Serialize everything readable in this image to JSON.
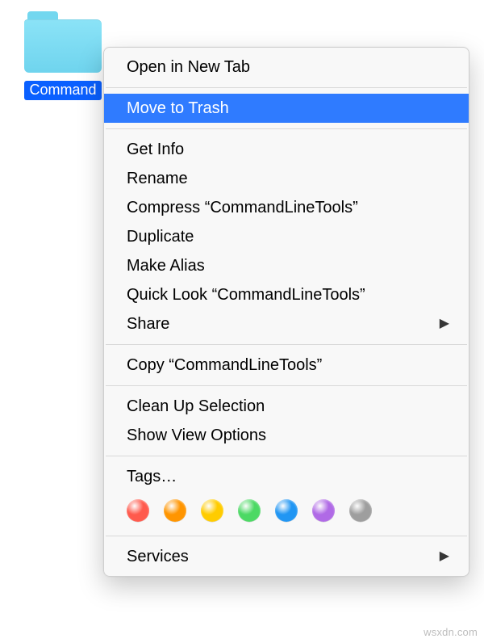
{
  "folder": {
    "label": "Command"
  },
  "menu": {
    "open_new_tab": "Open in New Tab",
    "move_to_trash": "Move to Trash",
    "get_info": "Get Info",
    "rename": "Rename",
    "compress": "Compress “CommandLineTools”",
    "duplicate": "Duplicate",
    "make_alias": "Make Alias",
    "quick_look": "Quick Look “CommandLineTools”",
    "share": "Share",
    "copy": "Copy “CommandLineTools”",
    "clean_up": "Clean Up Selection",
    "show_view_options": "Show View Options",
    "tags": "Tags…",
    "services": "Services"
  },
  "tag_colors": {
    "red": "#ff5a4d",
    "orange": "#ff9500",
    "yellow": "#ffcc00",
    "green": "#4cd964",
    "blue": "#2196f3",
    "purple": "#b06ae6",
    "gray": "#9e9e9e"
  },
  "highlight_color": "#2f7bff",
  "watermark": "wsxdn.com"
}
